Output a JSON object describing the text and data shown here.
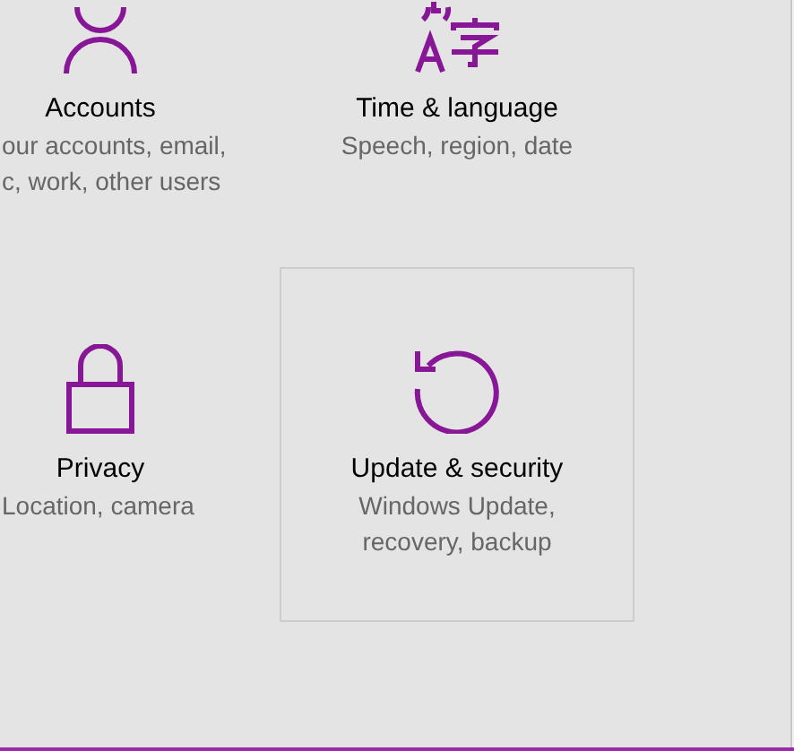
{
  "tiles": [
    {
      "kind": "person",
      "title": "Accounts",
      "description": [
        "our accounts, email,",
        "c, work, other users"
      ],
      "selected": false
    },
    {
      "kind": "language",
      "title": "Time & language",
      "description": [
        "Speech, region, date"
      ],
      "selected": false
    },
    {
      "kind": "lock",
      "title": "Privacy",
      "description": [
        "Location, camera"
      ],
      "selected": false
    },
    {
      "kind": "update",
      "title": "Update & security",
      "description": [
        "Windows Update,",
        "recovery, backup"
      ],
      "selected": true
    }
  ]
}
